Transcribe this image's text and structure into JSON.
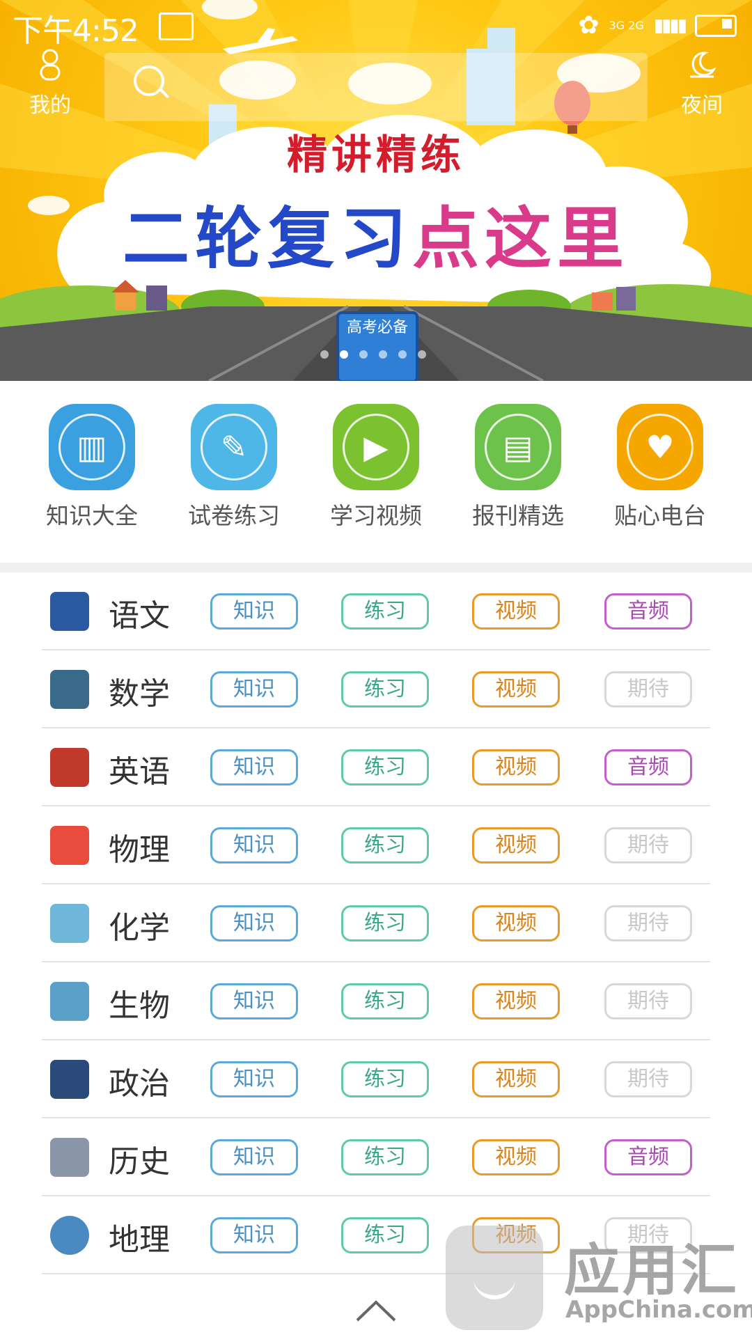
{
  "status_bar": {
    "time": "下午4:52",
    "network": "3G 2G"
  },
  "header": {
    "profile_label": "我的",
    "night_label": "夜间"
  },
  "banner": {
    "title_small": "精讲精练",
    "title_big_blue": "二轮复习",
    "title_big_pink": "点这里",
    "book_text": "高考必备",
    "slide_count": 6,
    "active_slide": 2
  },
  "categories": [
    {
      "label": "知识大全",
      "icon": "books-icon",
      "color": "#3aa0e0"
    },
    {
      "label": "试卷练习",
      "icon": "pencil-icon",
      "color": "#4fb6e8"
    },
    {
      "label": "学习视频",
      "icon": "tv-icon",
      "color": "#7cc230"
    },
    {
      "label": "报刊精选",
      "icon": "newspaper-icon",
      "color": "#6cc24a"
    },
    {
      "label": "贴心电台",
      "icon": "radio-icon",
      "color": "#f5a700"
    }
  ],
  "subjects": [
    {
      "name": "语文",
      "icon": "notebook-icon",
      "k": "知识",
      "p": "练习",
      "v": "视频",
      "a": "音频",
      "a_active": true
    },
    {
      "name": "数学",
      "icon": "blackboard-icon",
      "k": "知识",
      "p": "练习",
      "v": "视频",
      "a": "期待",
      "a_active": false
    },
    {
      "name": "英语",
      "icon": "owl-icon",
      "k": "知识",
      "p": "练习",
      "v": "视频",
      "a": "音频",
      "a_active": true
    },
    {
      "name": "物理",
      "icon": "apple-books-icon",
      "k": "知识",
      "p": "练习",
      "v": "视频",
      "a": "期待",
      "a_active": false
    },
    {
      "name": "化学",
      "icon": "flask-icon",
      "k": "知识",
      "p": "练习",
      "v": "视频",
      "a": "期待",
      "a_active": false
    },
    {
      "name": "生物",
      "icon": "leaf-icon",
      "k": "知识",
      "p": "练习",
      "v": "视频",
      "a": "期待",
      "a_active": false
    },
    {
      "name": "政治",
      "icon": "chess-king-icon",
      "k": "知识",
      "p": "练习",
      "v": "视频",
      "a": "期待",
      "a_active": false
    },
    {
      "name": "历史",
      "icon": "column-icon",
      "k": "知识",
      "p": "练习",
      "v": "视频",
      "a": "音频",
      "a_active": true
    },
    {
      "name": "地理",
      "icon": "globe-icon",
      "k": "知识",
      "p": "练习",
      "v": "视频",
      "a": "期待",
      "a_active": false
    }
  ],
  "watermark": {
    "title": "应用汇",
    "subtitle": "AppChina.com"
  }
}
